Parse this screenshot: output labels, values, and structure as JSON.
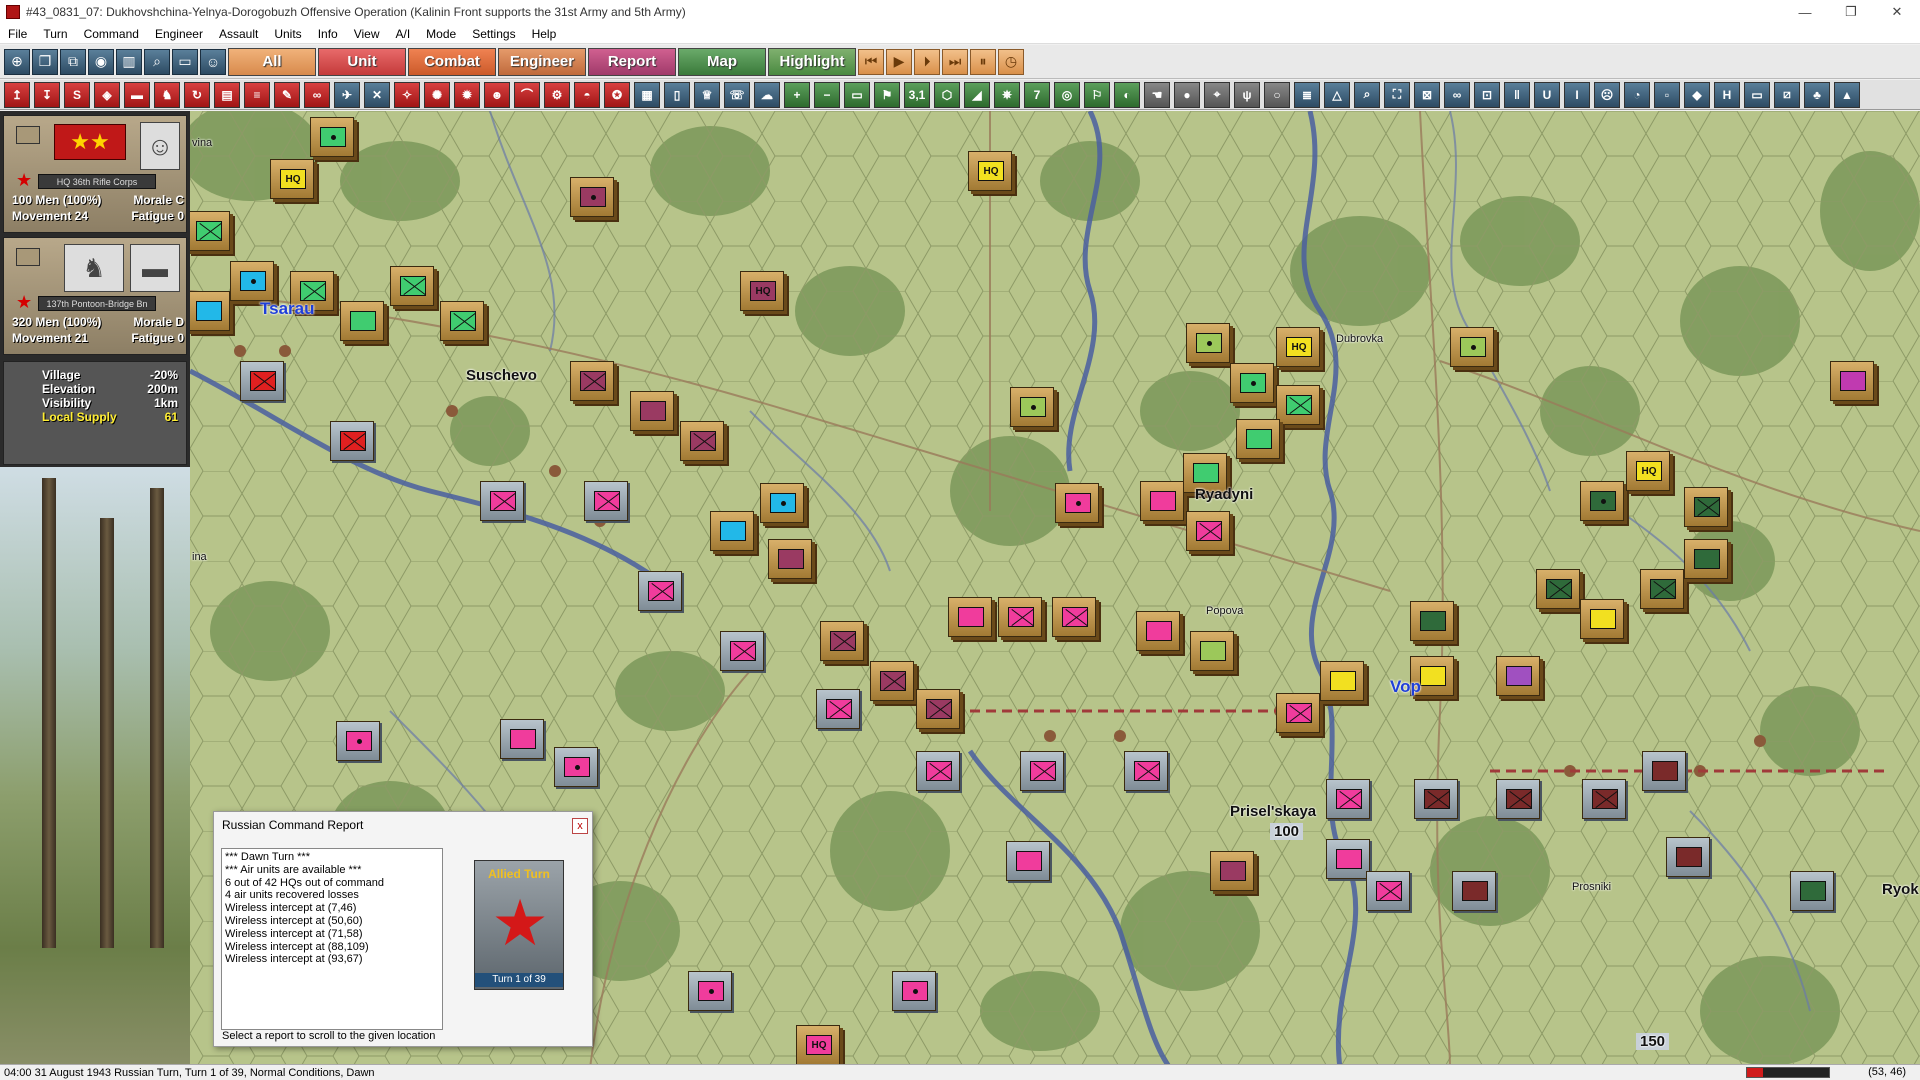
{
  "window": {
    "title": "#43_0831_07: Dukhovshchina-Yelnya-Dorogobuzh Offensive Operation (Kalinin Front supports the 31st Army and 5th Army)",
    "controls": [
      "—",
      "❐",
      "✕"
    ]
  },
  "menu": [
    "File",
    "Turn",
    "Command",
    "Engineer",
    "Assault",
    "Units",
    "Info",
    "View",
    "A/I",
    "Mode",
    "Settings",
    "Help"
  ],
  "tabs": [
    "All",
    "Unit",
    "Combat",
    "Engineer",
    "Report",
    "Map",
    "Highlight"
  ],
  "toolbar2_labels": {
    "range": "3,1",
    "seven": "7"
  },
  "units": [
    {
      "name": "HQ 36th Rifle Corps",
      "men": "100 Men (100%)",
      "morale": "Morale C",
      "movement": "Movement 24",
      "fatigue": "Fatigue 0"
    },
    {
      "name": "137th Pontoon-Bridge Bn",
      "men": "320 Men (100%)",
      "morale": "Morale D",
      "movement": "Movement 21",
      "fatigue": "Fatigue 0"
    }
  ],
  "terrain": {
    "type": "Village",
    "type_mod": "-20%",
    "elevation_label": "Elevation",
    "elevation": "200m",
    "visibility_label": "Visibility",
    "visibility": "1km",
    "supply_label": "Local Supply",
    "supply": "61"
  },
  "places": {
    "tsarau": "Tsarau",
    "suschevo": "Suschevo",
    "ryadyni": "Ryadyni",
    "dubrovka": "Dubrovka",
    "popova": "Popova",
    "vop": "Vop",
    "priselskaya": "Prisel'skaya",
    "prosniki": "Prosniki",
    "ryok": "Ryok",
    "vina1": "vina",
    "vina2": "ina",
    "val100": "100",
    "val150": "150"
  },
  "report": {
    "title": "Russian Command Report",
    "close": "x",
    "lines": [
      "*** Dawn Turn ***",
      "*** Air units are available ***",
      "6 out of 42 HQs out of command",
      "4 air units recovered losses",
      "Wireless intercept at (7,46)",
      "Wireless intercept at (50,60)",
      "Wireless intercept at (71,58)",
      "Wireless intercept at (88,109)",
      "Wireless intercept at (93,67)"
    ],
    "image_header": "Allied Turn",
    "image_turn": "Turn  1  of  39",
    "footer": "Select a report to scroll to the given location"
  },
  "status": {
    "text": "04:00 31 August 1943 Russian Turn, Turn 1 of 39, Normal Conditions, Dawn",
    "coords": "(53, 46)",
    "progress": 0.2
  },
  "colors": {
    "soviet_red": "#c01818",
    "map_base": "#b7c48a",
    "forest": "#7e9a5c",
    "river": "#4a5fa0"
  }
}
